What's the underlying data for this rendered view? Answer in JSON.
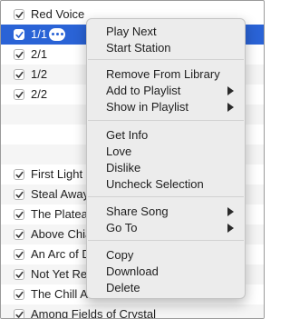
{
  "tracks": [
    {
      "title": "Red Voice",
      "checked": true,
      "selected": false
    },
    {
      "title": "1/1",
      "checked": true,
      "selected": true
    },
    {
      "title": "2/1",
      "checked": true,
      "selected": false
    },
    {
      "title": "1/2",
      "checked": true,
      "selected": false
    },
    {
      "title": "2/2",
      "checked": true,
      "selected": false
    },
    {
      "title": "",
      "checked": false,
      "selected": false
    },
    {
      "title": "",
      "checked": false,
      "selected": false
    },
    {
      "title": "",
      "checked": false,
      "selected": false
    },
    {
      "title": "First Light",
      "checked": true,
      "selected": false
    },
    {
      "title": "Steal Away",
      "checked": true,
      "selected": false
    },
    {
      "title": "The Plateau",
      "checked": true,
      "selected": false
    },
    {
      "title": "Above Chia",
      "checked": true,
      "selected": false
    },
    {
      "title": "An Arc of D",
      "checked": true,
      "selected": false
    },
    {
      "title": "Not Yet Rem",
      "checked": true,
      "selected": false
    },
    {
      "title": "The Chill A",
      "checked": true,
      "selected": false
    },
    {
      "title": "Among Fields of Crystal",
      "checked": true,
      "selected": false
    }
  ],
  "selected_row": {
    "more_icon": "ellipsis-icon"
  },
  "context_menu": {
    "groups": [
      [
        {
          "label": "Play Next"
        },
        {
          "label": "Start Station"
        }
      ],
      [
        {
          "label": "Remove From Library"
        },
        {
          "label": "Add to Playlist",
          "submenu": true
        },
        {
          "label": "Show in Playlist",
          "submenu": true
        }
      ],
      [
        {
          "label": "Get Info"
        },
        {
          "label": "Love"
        },
        {
          "label": "Dislike"
        },
        {
          "label": "Uncheck Selection"
        }
      ],
      [
        {
          "label": "Share Song",
          "submenu": true
        },
        {
          "label": "Go To",
          "submenu": true
        }
      ],
      [
        {
          "label": "Copy"
        },
        {
          "label": "Download"
        },
        {
          "label": "Delete"
        }
      ]
    ]
  },
  "colors": {
    "selection": "#2a63d6",
    "menu_bg": "#ececec"
  }
}
